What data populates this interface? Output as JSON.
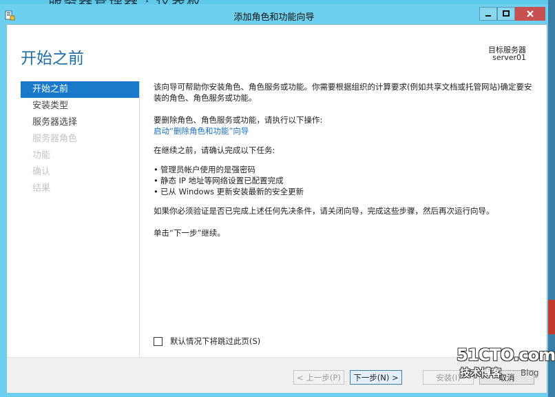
{
  "background": {
    "title": "服务器管理器 · 仪表板"
  },
  "window": {
    "title": "添加角色和功能向导"
  },
  "header": {
    "heading": "开始之前",
    "destination_label": "目标服务器",
    "destination_value": "server01"
  },
  "nav": {
    "items": [
      {
        "label": "开始之前",
        "state": "active"
      },
      {
        "label": "安装类型",
        "state": "normal"
      },
      {
        "label": "服务器选择",
        "state": "normal"
      },
      {
        "label": "服务器角色",
        "state": "disabled"
      },
      {
        "label": "功能",
        "state": "disabled"
      },
      {
        "label": "确认",
        "state": "disabled"
      },
      {
        "label": "结果",
        "state": "disabled"
      }
    ]
  },
  "content": {
    "intro": "该向导可帮助你安装角色、角色服务或功能。你需要根据组织的计算要求(例如共享文档或托管网站)确定要安装的角色、角色服务或功能。",
    "remove_prompt": "要删除角色、角色服务或功能，请执行以下操作:",
    "remove_link": "启动“删除角色和功能”向导",
    "confirm_prompt": "在继续之前，请确认完成以下任务:",
    "tasks": [
      "管理员帐户使用的是强密码",
      "静态 IP 地址等网络设置已配置完成",
      "已从 Windows 更新安装最新的安全更新"
    ],
    "verify_note": "如果你必须验证是否已完成上述任何先决条件，请关闭向导，完成这些步骤，然后再次运行向导。",
    "continue_note": "单击“下一步”继续。"
  },
  "skip": {
    "label": "默认情况下将跳过此页(S)",
    "checked": false
  },
  "buttons": {
    "prev": "< 上一步(P)",
    "next": "下一步(N) >",
    "install": "安装(I)",
    "cancel": "取消"
  },
  "watermark": {
    "main": "51CTO.com",
    "sub": "技术博客",
    "blog": "Blog"
  },
  "colors": {
    "accent": "#1979ca",
    "link": "#1a6fc2",
    "titlebar": "#6cd0ee",
    "close": "#c75050"
  }
}
